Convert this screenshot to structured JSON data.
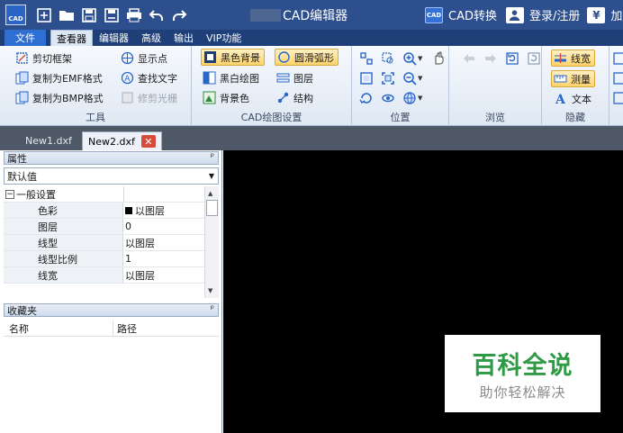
{
  "titlebar": {
    "app_title": "CAD编辑器",
    "cad_convert": "CAD转换",
    "login": "登录/注册",
    "overflow": "加",
    "logo_text": "CAD",
    "cad_convert_icon_text": "CAD",
    "yen": "¥"
  },
  "menu": {
    "file": "文件",
    "viewer": "查看器",
    "editor": "编辑器",
    "advanced": "高级",
    "output": "输出",
    "vip": "VIP功能"
  },
  "ribbon": {
    "tools": {
      "title": "工具",
      "clip_frame": "剪切框架",
      "copy_emf": "复制为EMF格式",
      "copy_bmp": "复制为BMP格式",
      "show_points": "显示点",
      "find_text": "查找文字",
      "trim_raster": "修剪光栅"
    },
    "drawing": {
      "title": "CAD绘图设置",
      "black_bg": "黑色背景",
      "smooth_arc": "圆滑弧形",
      "bw_drawing": "黑白绘图",
      "layers": "图层",
      "bg_color": "背景色",
      "structure": "结构"
    },
    "position": {
      "title": "位置"
    },
    "browse": {
      "title": "浏览"
    },
    "hide": {
      "title": "隐藏",
      "line_width": "线宽",
      "measure": "测量",
      "text": "文本"
    }
  },
  "doctabs": {
    "tab1": "New1.dxf",
    "tab2": "New2.dxf"
  },
  "properties": {
    "title": "属性",
    "pin": "ᵖ",
    "selector": "默认值",
    "category": "一般设置",
    "rows": [
      {
        "key": "色彩",
        "value": "以图层"
      },
      {
        "key": "图层",
        "value": "0"
      },
      {
        "key": "线型",
        "value": "以图层"
      },
      {
        "key": "线型比例",
        "value": "1"
      },
      {
        "key": "线宽",
        "value": "以图层"
      }
    ]
  },
  "favorites": {
    "title": "收藏夹",
    "pin": "ᵖ",
    "col_name": "名称",
    "col_path": "路径"
  },
  "watermark": {
    "line1": "百科全说",
    "line2": "助你轻松解决"
  }
}
